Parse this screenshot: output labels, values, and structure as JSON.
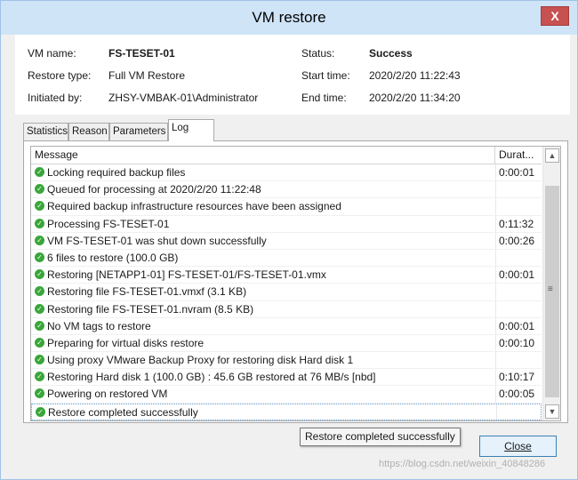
{
  "window": {
    "title": "VM restore",
    "close_glyph": "X"
  },
  "info": {
    "vm_name_label": "VM name:",
    "vm_name_value": "FS-TESET-01",
    "restore_type_label": "Restore type:",
    "restore_type_value": "Full VM Restore",
    "initiated_by_label": "Initiated by:",
    "initiated_by_value": "ZHSY-VMBAK-01\\Administrator",
    "status_label": "Status:",
    "status_value": "Success",
    "start_time_label": "Start time:",
    "start_time_value": "2020/2/20 11:22:43",
    "end_time_label": "End time:",
    "end_time_value": "2020/2/20 11:34:20"
  },
  "tabs": [
    {
      "label": "Statistics",
      "active": false
    },
    {
      "label": "Reason",
      "active": false
    },
    {
      "label": "Parameters",
      "active": false
    },
    {
      "label": "Log",
      "active": true
    }
  ],
  "log": {
    "columns": {
      "message": "Message",
      "duration": "Durat..."
    },
    "rows": [
      {
        "icon": "success-check-icon",
        "message": "Locking required backup files",
        "duration": "0:00:01"
      },
      {
        "icon": "success-check-icon",
        "message": "Queued for processing at 2020/2/20 11:22:48",
        "duration": ""
      },
      {
        "icon": "success-check-icon",
        "message": "Required backup infrastructure resources have been assigned",
        "duration": ""
      },
      {
        "icon": "success-check-icon",
        "message": "Processing FS-TESET-01",
        "duration": "0:11:32"
      },
      {
        "icon": "success-check-icon",
        "message": "VM FS-TESET-01 was shut down successfully",
        "duration": "0:00:26"
      },
      {
        "icon": "success-check-icon",
        "message": "6 files to restore (100.0 GB)",
        "duration": ""
      },
      {
        "icon": "success-check-icon",
        "message": "Restoring [NETAPP1-01] FS-TESET-01/FS-TESET-01.vmx",
        "duration": "0:00:01"
      },
      {
        "icon": "success-check-icon",
        "message": "Restoring file FS-TESET-01.vmxf (3.1 KB)",
        "duration": ""
      },
      {
        "icon": "success-check-icon",
        "message": "Restoring file FS-TESET-01.nvram (8.5 KB)",
        "duration": ""
      },
      {
        "icon": "success-check-icon",
        "message": "No VM tags to restore",
        "duration": "0:00:01"
      },
      {
        "icon": "success-check-icon",
        "message": "Preparing for virtual disks restore",
        "duration": "0:00:10"
      },
      {
        "icon": "success-check-icon",
        "message": "Using proxy VMware Backup Proxy for restoring disk Hard disk 1",
        "duration": ""
      },
      {
        "icon": "success-check-icon",
        "message": "Restoring Hard disk 1 (100.0 GB) : 45.6 GB restored at 76 MB/s  [nbd]",
        "duration": "0:10:17"
      },
      {
        "icon": "success-check-icon",
        "message": "Powering on restored VM",
        "duration": "0:00:05"
      },
      {
        "icon": "success-check-icon",
        "message": "Restore completed successfully",
        "duration": "",
        "selected": true
      }
    ]
  },
  "tooltip": "Restore completed successfully",
  "close_button": "Close",
  "watermark": "https://blog.csdn.net/weixin_40848286",
  "colors": {
    "success": "#3aa63a",
    "titlebar": "#cfe4f7",
    "close_button_bg": "#c75050"
  }
}
